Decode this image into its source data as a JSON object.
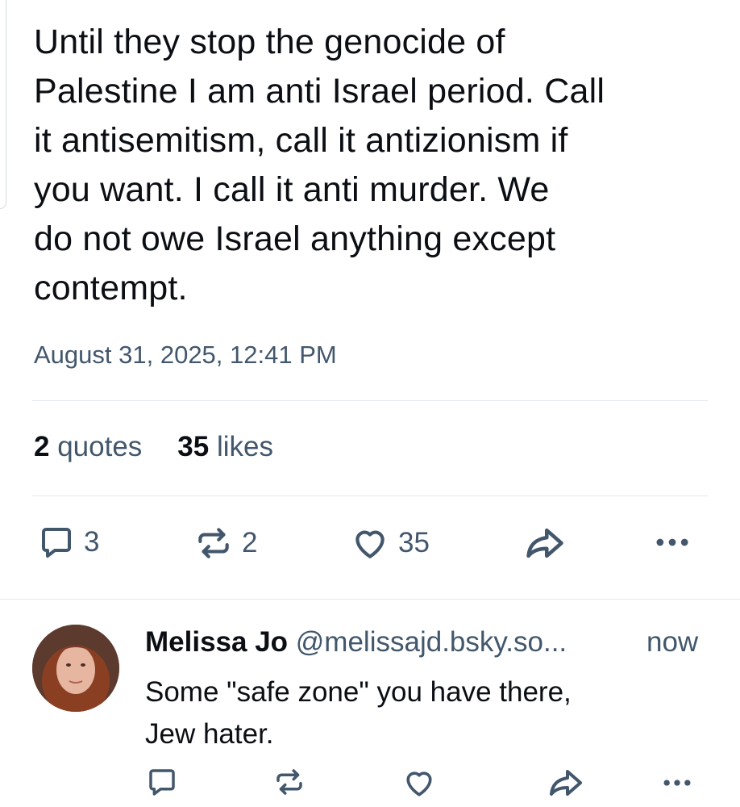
{
  "post": {
    "text": "Until they stop the genocide of\nPalestine I am anti Israel period. Call\nit antisemitism, call it antizionism if\nyou want. I call it anti murder. We\ndo not owe Israel anything except\ncontempt.",
    "timestamp": "August 31, 2025, 12:41 PM",
    "stats": {
      "quotes_count": "2",
      "quotes_label": "quotes",
      "likes_count": "35",
      "likes_label": "likes"
    },
    "actions": {
      "reply_icon": "comment-icon",
      "reply_count": "3",
      "repost_icon": "repost-icon",
      "repost_count": "2",
      "like_icon": "heart-icon",
      "like_count": "35",
      "share_icon": "share-icon",
      "more_icon": "more-icon"
    }
  },
  "reply": {
    "author_name": "Melissa Jo",
    "author_handle": "@melissajd.bsky.so...",
    "time": "now",
    "text": "Some \"safe zone\" you have there,\nJew hater.",
    "actions": [
      "comment-icon",
      "repost-icon",
      "heart-icon",
      "share-icon",
      "more-icon"
    ]
  },
  "colors": {
    "text": "#0b0f14",
    "muted": "#42576c",
    "divider": "#e3e8ed"
  }
}
